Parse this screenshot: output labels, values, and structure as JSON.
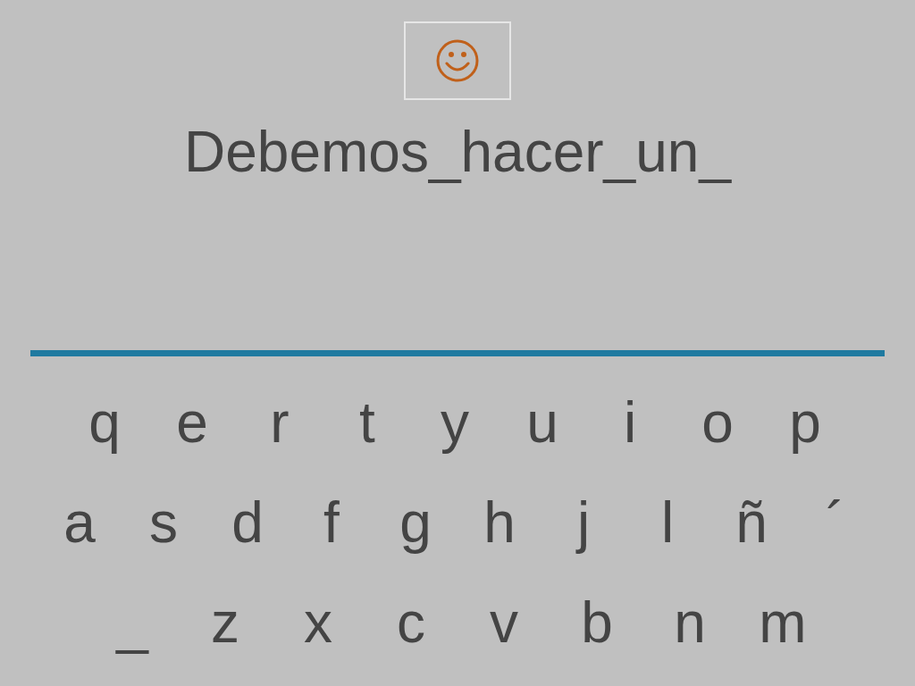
{
  "phrase": "Debemos_hacer_un_",
  "keyboard": {
    "rows": [
      [
        "q",
        "e",
        "r",
        "t",
        "y",
        "u",
        "i",
        "o",
        "p"
      ],
      [
        "a",
        "s",
        "d",
        "f",
        "g",
        "h",
        "j",
        "l",
        "ñ",
        "´"
      ],
      [
        "_",
        "z",
        "x",
        "c",
        "v",
        "b",
        "n",
        "m"
      ]
    ]
  }
}
